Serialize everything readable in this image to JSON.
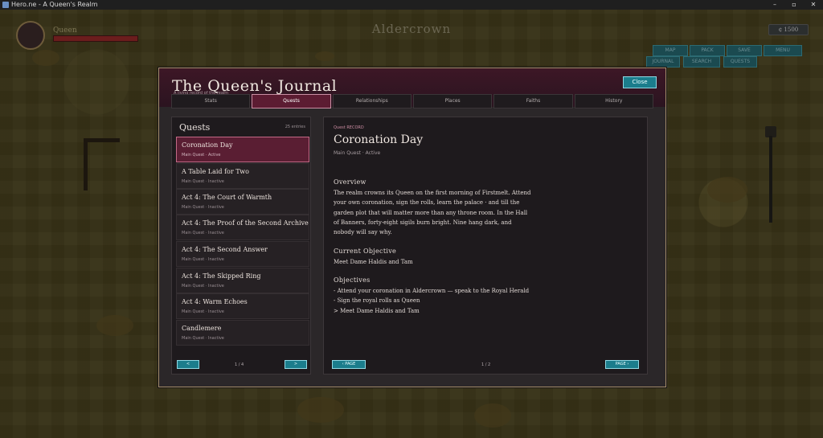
{
  "window": {
    "title": "Hero.ne - A Queen's Realm",
    "controls": [
      "–",
      "▫",
      "✕"
    ]
  },
  "hud": {
    "player_name": "Queen",
    "location": "Aldercrown",
    "gold": "¢ 1500",
    "buttons_row1": [
      "MAP",
      "PACK",
      "SAVE",
      "MENU"
    ],
    "buttons_row2": [
      "JOURNAL",
      "SEARCH",
      "QUESTS"
    ]
  },
  "journal": {
    "title": "The Queen's Journal",
    "subtitle": "A living record of the realm",
    "close_label": "Close",
    "tabs": [
      "Stats",
      "Quests",
      "Relationships",
      "Places",
      "Faiths",
      "History"
    ],
    "active_tab": "Quests",
    "quest_list": {
      "title": "Quests",
      "count": "25 entries",
      "items": [
        {
          "name": "Coronation Day",
          "status": "Main Quest · Active",
          "active": true
        },
        {
          "name": "A Table Laid for Two",
          "status": "Main Quest · Inactive"
        },
        {
          "name": "Act 4: The Court of Warmth",
          "status": "Main Quest · Inactive"
        },
        {
          "name": "Act 4: The Proof of the Second Archive",
          "status": "Main Quest · Inactive"
        },
        {
          "name": "Act 4: The Second Answer",
          "status": "Main Quest · Inactive"
        },
        {
          "name": "Act 4: The Skipped Ring",
          "status": "Main Quest · Inactive"
        },
        {
          "name": "Act 4: Warm Echoes",
          "status": "Main Quest · Inactive"
        },
        {
          "name": "Candlemere",
          "status": "Main Quest · Inactive"
        }
      ],
      "prev_label": "<",
      "next_label": ">",
      "page": "1 / 4"
    },
    "detail": {
      "label": "Quest RECORD",
      "title": "Coronation Day",
      "subtitle": "Main Quest · Active",
      "overview_heading": "Overview",
      "overview_lines": [
        "The realm crowns its Queen on the first morning of Firstmelt. Attend",
        "your own coronation, sign the rolls, learn the palace · and till the",
        "garden plot that will matter more than any throne room. In the Hall",
        "of Banners, forty-eight sigils burn bright. Nine hang dark, and",
        "nobody will say why."
      ],
      "objective_heading": "Current Objective",
      "objective": "Meet Dame Haldis and Tam",
      "objectives_heading": "Objectives",
      "objectives": [
        "- Attend your coronation in Aldercrown — speak to the Royal Herald",
        "- Sign the royal rolls as Queen",
        "> Meet Dame Haldis and Tam"
      ],
      "prev_page_label": "‹ PAGE",
      "next_page_label": "PAGE ›",
      "page": "1 / 2"
    }
  },
  "colors": {
    "accent_teal": "#1b7d8c",
    "active_tab": "#5c1c32",
    "header": "#3d1726"
  }
}
